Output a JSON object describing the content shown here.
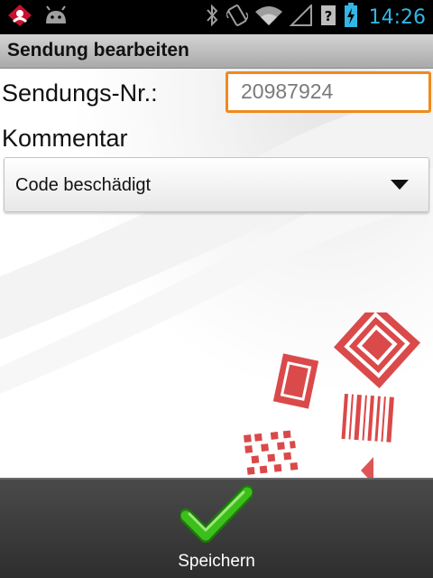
{
  "status_bar": {
    "time": "14:26",
    "icons": [
      "app-notification-icon",
      "android-icon",
      "bluetooth-icon",
      "vibrate-icon",
      "wifi-icon",
      "signal-icon",
      "unknown-sim-icon",
      "battery-charging-icon"
    ],
    "time_color": "#33b5e5"
  },
  "title_bar": {
    "title": "Sendung bearbeiten"
  },
  "form": {
    "shipment_label": "Sendungs-Nr.:",
    "shipment_number": "20987924",
    "comment_label": "Kommentar",
    "comment_selected": "Code beschädigt"
  },
  "bottom_bar": {
    "save_label": "Speichern"
  },
  "colors": {
    "focus_border": "#f08a1c",
    "check_green": "#3cbf1a",
    "watermark_red": "#d42a2a"
  }
}
